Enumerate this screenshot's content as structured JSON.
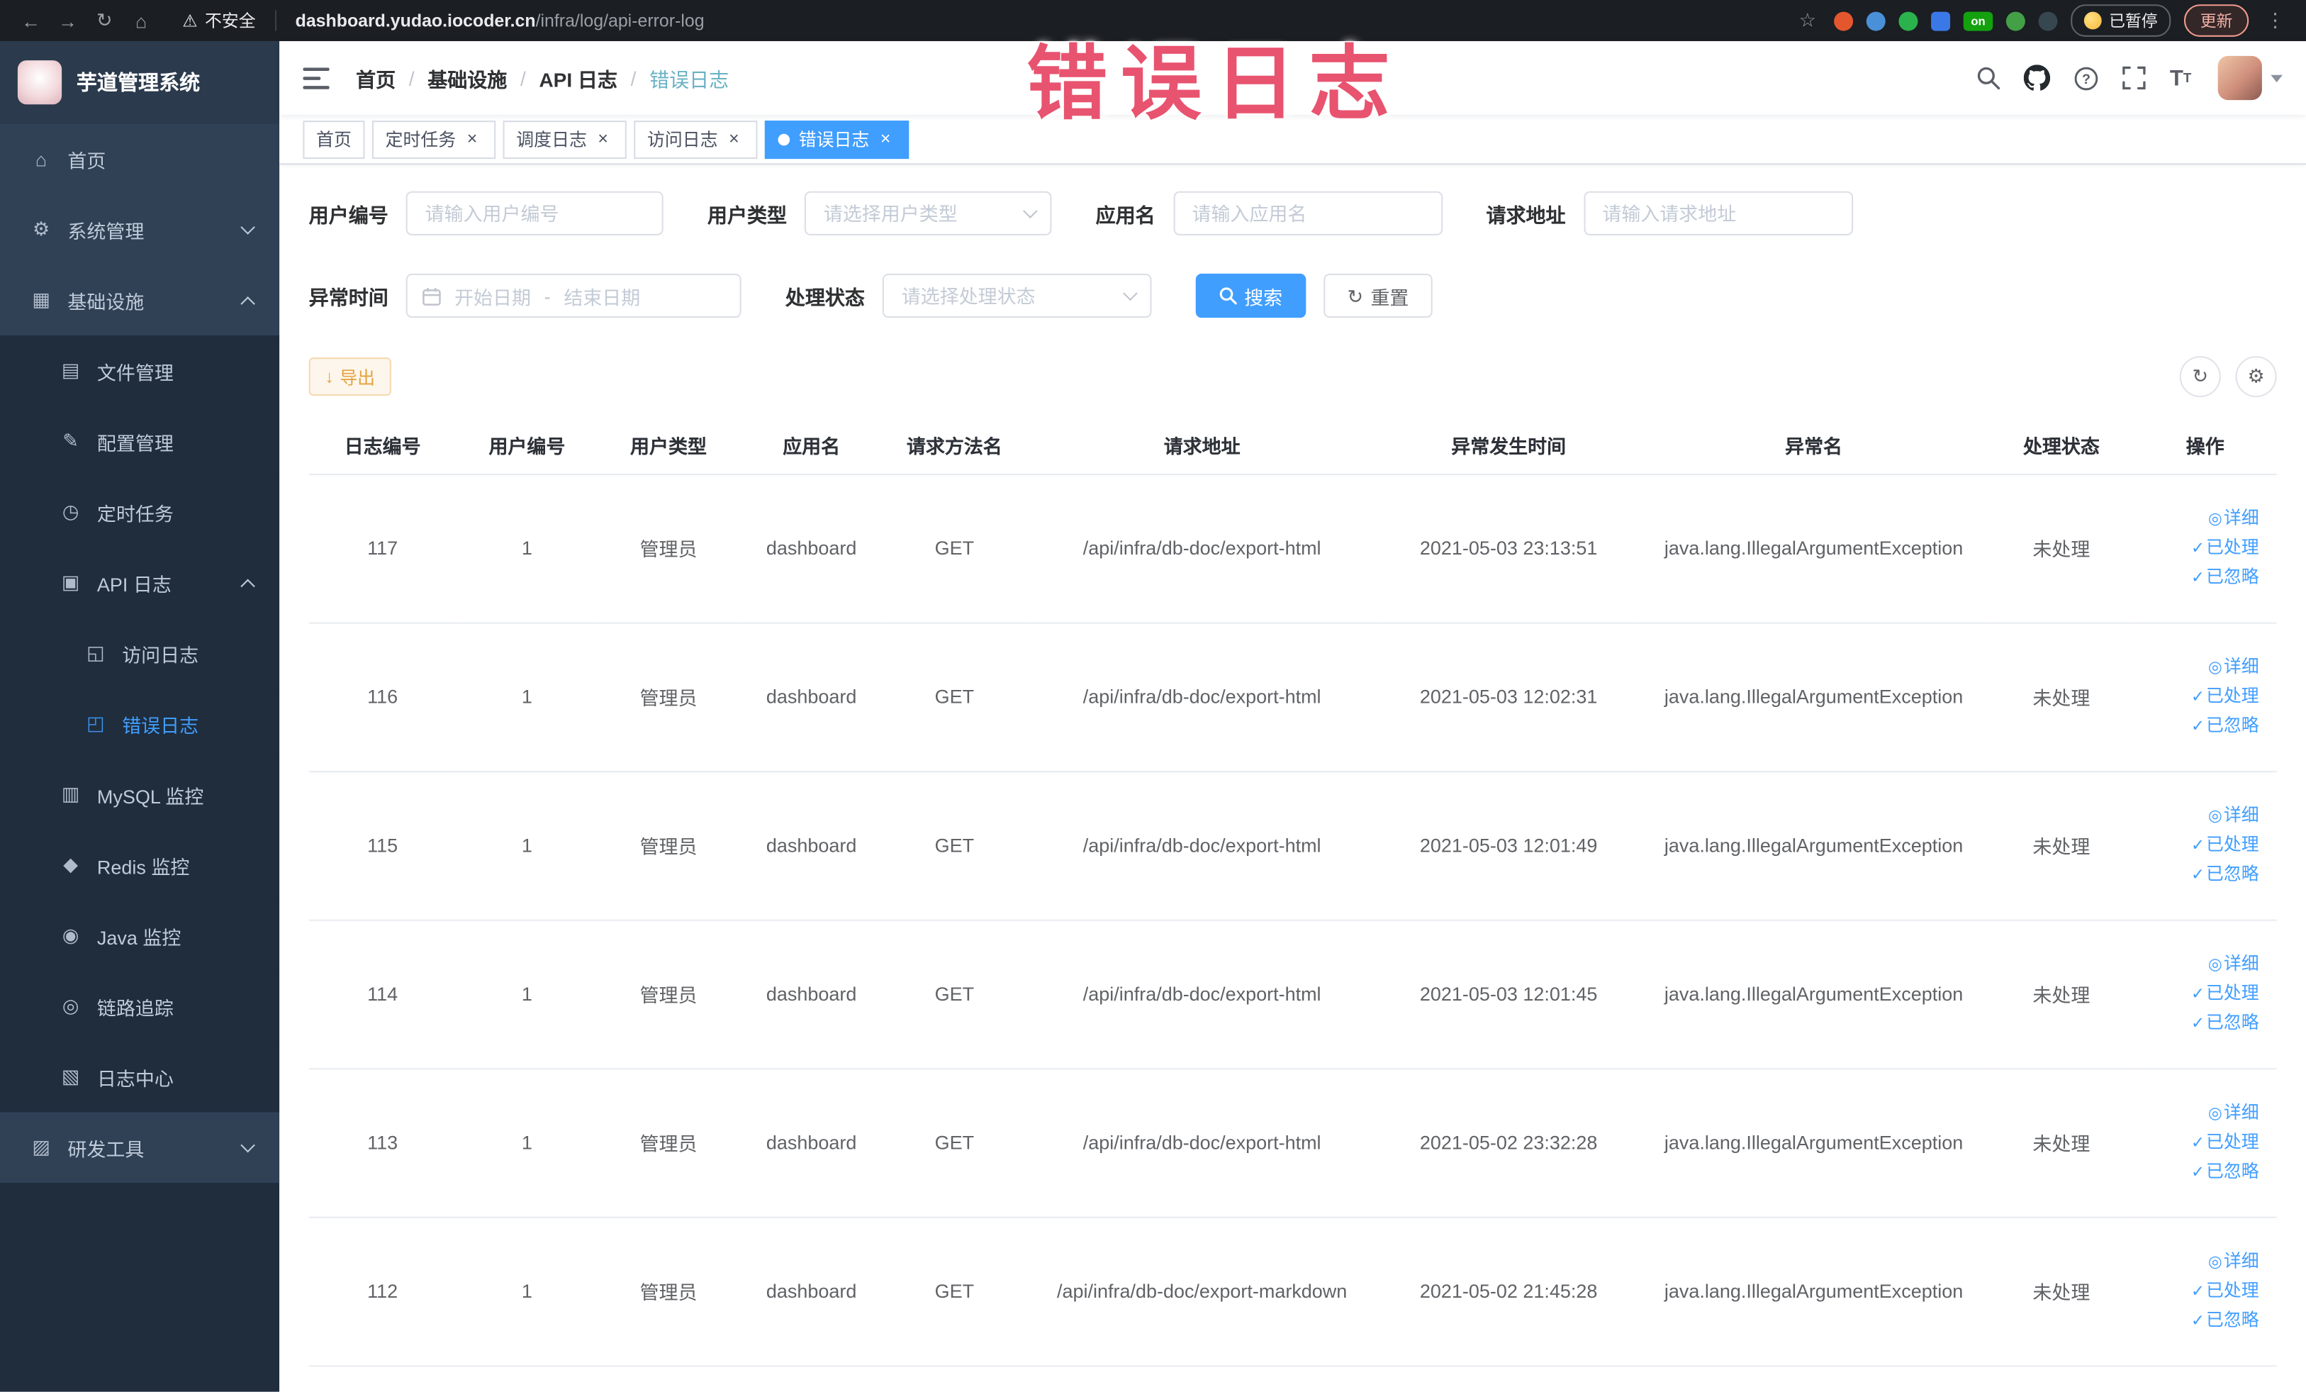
{
  "browser": {
    "security_label": "不安全",
    "url": {
      "domain": "dashboard.yudao.iocoder.cn",
      "path": "/infra/log/api-error-log"
    },
    "extension_badge": "on",
    "paused_badge": "已暂停",
    "update_label": "更新"
  },
  "annotation": {
    "text": "错误日志",
    "color": "#e8536f"
  },
  "icons": {
    "back": "←",
    "forward": "→",
    "reload": "↻",
    "home": "⌂",
    "warning": "⚠",
    "star": "☆",
    "menu_dots": "⋮",
    "refresh": "↻",
    "settings": "⚙",
    "download": "↓"
  },
  "sidebar": {
    "logo_title": "芋道管理系统",
    "menu": [
      {
        "key": "home",
        "label": "首页",
        "icon": "home-icon",
        "glyph": "⌂",
        "level": 1
      },
      {
        "key": "system",
        "label": "系统管理",
        "icon": "gear-icon",
        "glyph": "⚙",
        "level": 1,
        "arrow": "down"
      },
      {
        "key": "infra",
        "label": "基础设施",
        "icon": "monitor-icon",
        "glyph": "▦",
        "level": 1,
        "arrow": "up"
      },
      {
        "key": "file",
        "label": "文件管理",
        "icon": "file-icon",
        "glyph": "▤",
        "level": 2
      },
      {
        "key": "config",
        "label": "配置管理",
        "icon": "edit-icon",
        "glyph": "✎",
        "level": 2
      },
      {
        "key": "job",
        "label": "定时任务",
        "icon": "clock-icon",
        "glyph": "◷",
        "level": 2
      },
      {
        "key": "api-log",
        "label": "API 日志",
        "icon": "api-log-icon",
        "glyph": "▣",
        "level": 2,
        "arrow": "up"
      },
      {
        "key": "access-log",
        "label": "访问日志",
        "icon": "access-log-icon",
        "glyph": "◱",
        "level": 3
      },
      {
        "key": "error-log",
        "label": "错误日志",
        "icon": "error-log-icon",
        "glyph": "◰",
        "level": 3,
        "active": true
      },
      {
        "key": "mysql",
        "label": "MySQL 监控",
        "icon": "mysql-icon",
        "glyph": "▥",
        "level": 2
      },
      {
        "key": "redis",
        "label": "Redis 监控",
        "icon": "redis-icon",
        "glyph": "◆",
        "level": 2
      },
      {
        "key": "java",
        "label": "Java 监控",
        "icon": "java-icon",
        "glyph": "◉",
        "level": 2
      },
      {
        "key": "trace",
        "label": "链路追踪",
        "icon": "trace-icon",
        "glyph": "◎",
        "level": 2
      },
      {
        "key": "log-center",
        "label": "日志中心",
        "icon": "log-center-icon",
        "glyph": "▧",
        "level": 2
      },
      {
        "key": "devtools",
        "label": "研发工具",
        "icon": "tools-icon",
        "glyph": "▨",
        "level": 1,
        "arrow": "down"
      }
    ]
  },
  "breadcrumb": [
    "首页",
    "基础设施",
    "API 日志",
    "错误日志"
  ],
  "tabs": [
    {
      "key": "home",
      "label": "首页",
      "closable": false,
      "active": false
    },
    {
      "key": "job",
      "label": "定时任务",
      "closable": true,
      "active": false
    },
    {
      "key": "job-log",
      "label": "调度日志",
      "closable": true,
      "active": false
    },
    {
      "key": "access-log",
      "label": "访问日志",
      "closable": true,
      "active": false
    },
    {
      "key": "error-log",
      "label": "错误日志",
      "closable": true,
      "active": true
    }
  ],
  "filters": {
    "user_id": {
      "label": "用户编号",
      "placeholder": "请输入用户编号"
    },
    "user_type": {
      "label": "用户类型",
      "placeholder": "请选择用户类型"
    },
    "app_name": {
      "label": "应用名",
      "placeholder": "请输入应用名"
    },
    "request_url": {
      "label": "请求地址",
      "placeholder": "请输入请求地址"
    },
    "exception_time": {
      "label": "异常时间",
      "start_placeholder": "开始日期",
      "separator": "-",
      "end_placeholder": "结束日期"
    },
    "status": {
      "label": "处理状态",
      "placeholder": "请选择处理状态"
    },
    "search_label": "搜索",
    "reset_label": "重置"
  },
  "toolbar": {
    "export_label": "导出"
  },
  "table": {
    "columns": [
      "日志编号",
      "用户编号",
      "用户类型",
      "应用名",
      "请求方法名",
      "请求地址",
      "异常发生时间",
      "异常名",
      "处理状态",
      "操作"
    ],
    "rows": [
      {
        "id": "117",
        "user_id": "1",
        "user_type": "管理员",
        "app": "dashboard",
        "method": "GET",
        "url": "/api/infra/db-doc/export-html",
        "time": "2021-05-03 23:13:51",
        "exception": "java.lang.IllegalArgumentException",
        "status": "未处理"
      },
      {
        "id": "116",
        "user_id": "1",
        "user_type": "管理员",
        "app": "dashboard",
        "method": "GET",
        "url": "/api/infra/db-doc/export-html",
        "time": "2021-05-03 12:02:31",
        "exception": "java.lang.IllegalArgumentException",
        "status": "未处理"
      },
      {
        "id": "115",
        "user_id": "1",
        "user_type": "管理员",
        "app": "dashboard",
        "method": "GET",
        "url": "/api/infra/db-doc/export-html",
        "time": "2021-05-03 12:01:49",
        "exception": "java.lang.IllegalArgumentException",
        "status": "未处理"
      },
      {
        "id": "114",
        "user_id": "1",
        "user_type": "管理员",
        "app": "dashboard",
        "method": "GET",
        "url": "/api/infra/db-doc/export-html",
        "time": "2021-05-03 12:01:45",
        "exception": "java.lang.IllegalArgumentException",
        "status": "未处理"
      },
      {
        "id": "113",
        "user_id": "1",
        "user_type": "管理员",
        "app": "dashboard",
        "method": "GET",
        "url": "/api/infra/db-doc/export-html",
        "time": "2021-05-02 23:32:28",
        "exception": "java.lang.IllegalArgumentException",
        "status": "未处理"
      },
      {
        "id": "112",
        "user_id": "1",
        "user_type": "管理员",
        "app": "dashboard",
        "method": "GET",
        "url": "/api/infra/db-doc/export-markdown",
        "time": "2021-05-02 21:45:28",
        "exception": "java.lang.IllegalArgumentException",
        "status": "未处理"
      }
    ],
    "row_actions": [
      {
        "name": "detail",
        "icon": "◎",
        "label": "详细"
      },
      {
        "name": "processed",
        "icon": "✓",
        "label": "已处理"
      },
      {
        "name": "ignored",
        "icon": "✓",
        "label": "已忽略"
      }
    ]
  },
  "colors": {
    "primary": "#409eff",
    "warning": "#e6a23c",
    "sidebar_bg": "#304156",
    "submenu_bg": "#1f2d3d"
  }
}
